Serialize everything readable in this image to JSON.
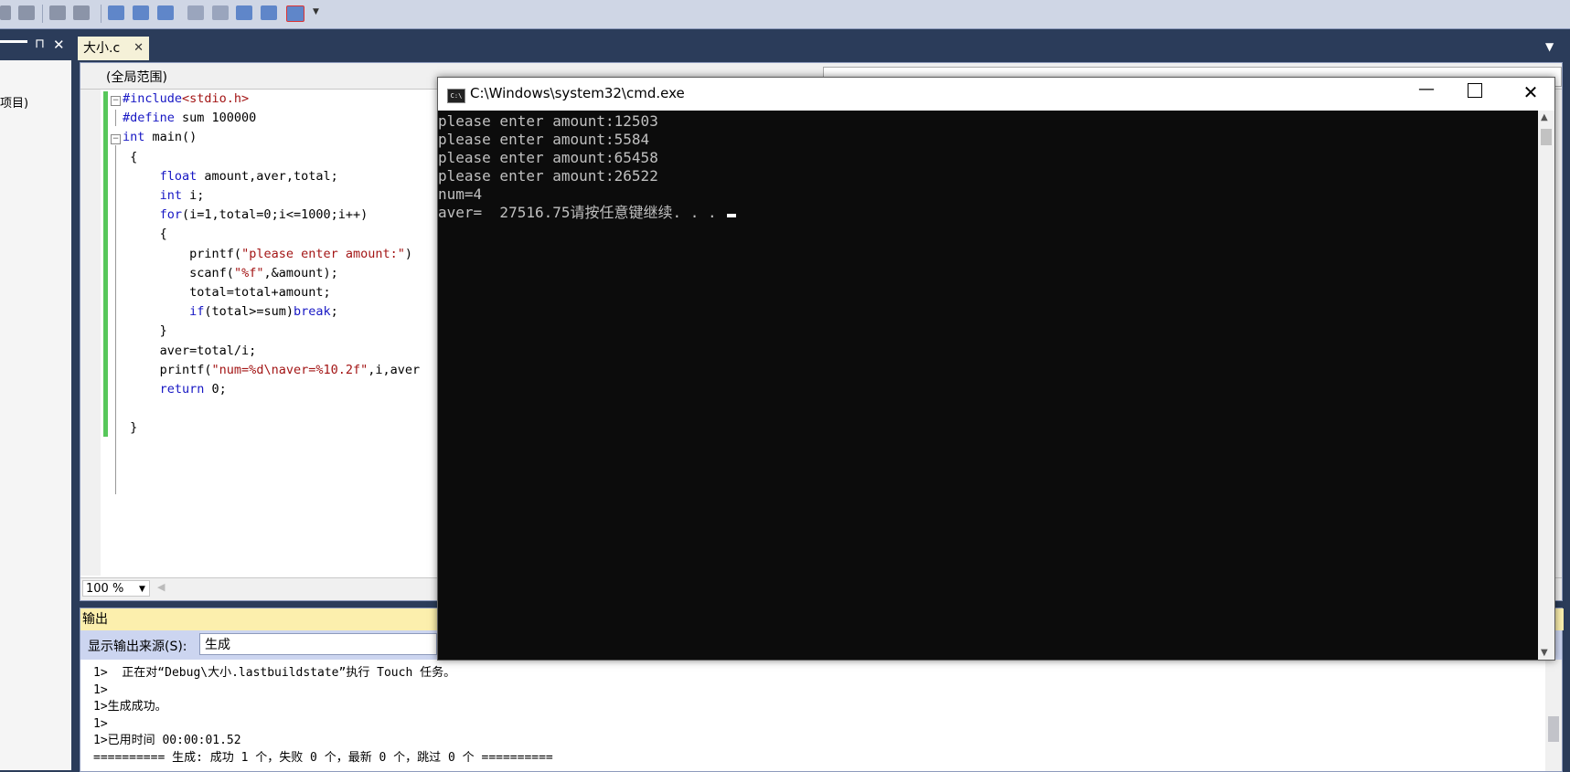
{
  "editor": {
    "file_tab": "大小.c",
    "scope": "(全局范围)",
    "zoom": "100 %",
    "code": {
      "line1_pp": "#include",
      "line1_rest": "<stdio.h>",
      "line2_pp": "#define",
      "line2_rest": " sum 100000",
      "line3_kw": "int",
      "line3_rest": " main()",
      "line4": " {",
      "line5_kw": "float",
      "line5_rest": " amount,aver,total;",
      "line6_kw": "int",
      "line6_rest": " i;",
      "line7_kw": "for",
      "line7_rest": "(i=1,total=0;i<=1000;i++)",
      "line8": "{",
      "line9_a": "printf(",
      "line9_str": "\"please enter amount:\"",
      "line9_b": ")",
      "line10_a": "scanf(",
      "line10_str": "\"%f\"",
      "line10_b": ",&amount);",
      "line11": "total=total+amount;",
      "line12_kw": "if",
      "line12_a": "(total>=sum)",
      "line12_kw2": "break",
      "line12_b": ";",
      "line13": "}",
      "line14": "aver=total/i;",
      "line15_a": "printf(",
      "line15_str": "\"num=%d\\naver=%10.2f\"",
      "line15_b": ",i,aver",
      "line16_kw": "return",
      "line16_rest": " 0;",
      "line17": " }"
    }
  },
  "left_panel": {
    "item": "项目)",
    "pin": "⊓",
    "close": "✕"
  },
  "output": {
    "title": "输出",
    "source_label": "显示输出来源(S):",
    "source_value": "生成",
    "lines": [
      "1>  正在对“Debug\\大小.lastbuildstate”执行 Touch 任务。",
      "1>",
      "1>生成成功。",
      "1>",
      "1>已用时间 00:00:01.52",
      "========== 生成: 成功 1 个，失败 0 个，最新 0 个，跳过 0 个 =========="
    ]
  },
  "cmd": {
    "title": "C:\\Windows\\system32\\cmd.exe",
    "icon_text": "C:\\",
    "lines": [
      "please enter amount:12503",
      "please enter amount:5584",
      "please enter amount:65458",
      "please enter amount:26522",
      "num=4",
      "aver=  27516.75请按任意键继续. . . "
    ]
  }
}
